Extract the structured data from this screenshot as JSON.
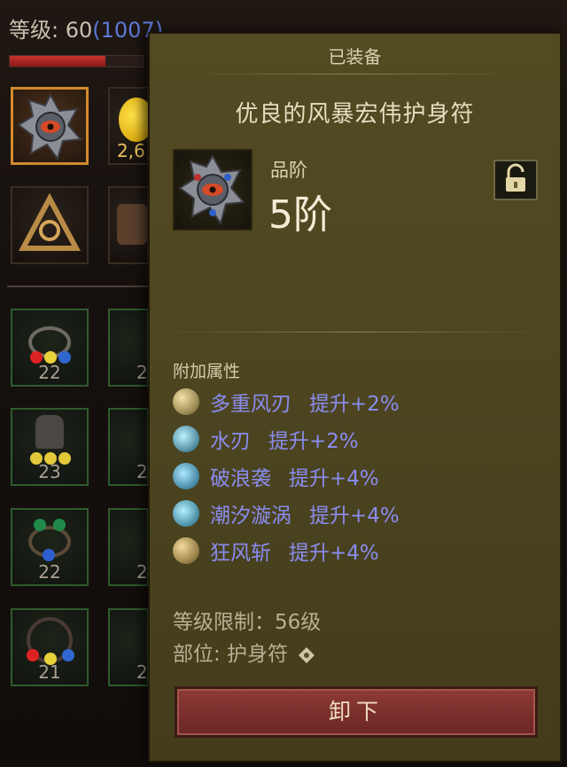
{
  "header": {
    "level_label": "等级: 60",
    "level_extra": "(1007)",
    "xp_fraction": 0.72
  },
  "inventory": {
    "currency_label": "2,6",
    "slots": [
      {
        "id": "ring-1",
        "count": "22"
      },
      {
        "id": "ring-2",
        "count": "2"
      },
      {
        "id": "gloves",
        "count": "23"
      },
      {
        "id": "boots",
        "count": "2"
      },
      {
        "id": "ring-3",
        "count": "22"
      },
      {
        "id": "ring-4",
        "count": "2"
      },
      {
        "id": "ring-5",
        "count": "21"
      },
      {
        "id": "ring-6",
        "count": "2"
      }
    ]
  },
  "tooltip": {
    "status": "已装备",
    "item_name": "优良的风暴宏伟护身符",
    "tier_label": "品阶",
    "tier_value": "5阶",
    "section_title": "附加属性",
    "affixes": [
      {
        "name": "多重风刃",
        "bonus": "提升+2%",
        "icon": "wind-blades-icon",
        "color": "#c9b37a"
      },
      {
        "name": "水刃",
        "bonus": "提升+2%",
        "icon": "water-blade-icon",
        "color": "#3fa7c2"
      },
      {
        "name": "破浪袭",
        "bonus": "提升+4%",
        "icon": "wave-break-icon",
        "color": "#3b9cc4"
      },
      {
        "name": "潮汐漩涡",
        "bonus": "提升+4%",
        "icon": "tidal-vortex-icon",
        "color": "#3aa6c8"
      },
      {
        "name": "狂风斩",
        "bonus": "提升+4%",
        "icon": "gale-slash-icon",
        "color": "#c9a95e"
      }
    ],
    "level_req": "等级限制：56级",
    "slot_label": "部位: 护身符",
    "unequip_label": "卸下"
  },
  "colors": {
    "accent_orange": "#d38a2b",
    "affix_blue": "#8a8cf0",
    "panel": "#4c4520",
    "button_red": "#8e3a36"
  }
}
